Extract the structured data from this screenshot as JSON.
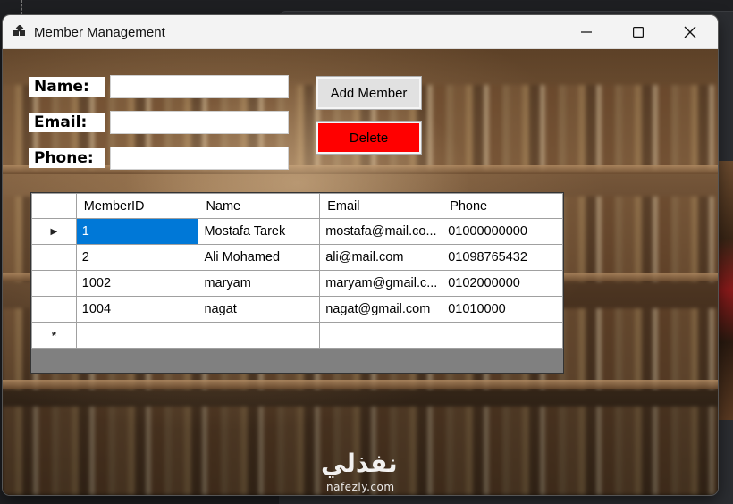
{
  "window": {
    "title": "Member Management"
  },
  "form": {
    "name_label": "Name:",
    "email_label": "Email:",
    "phone_label": "Phone:",
    "name_value": "",
    "email_value": "",
    "phone_value": ""
  },
  "buttons": {
    "add_label": "Add Member",
    "delete_label": "Delete"
  },
  "grid": {
    "columns": [
      "MemberID",
      "Name",
      "Email",
      "Phone"
    ],
    "rows": [
      {
        "id": "1",
        "name": "Mostafa Tarek",
        "email": "mostafa@mail.co...",
        "phone": "01000000000"
      },
      {
        "id": "2",
        "name": "Ali Mohamed",
        "email": "ali@mail.com",
        "phone": "01098765432"
      },
      {
        "id": "1002",
        "name": "maryam",
        "email": "maryam@gmail.c...",
        "phone": "0102000000"
      },
      {
        "id": "1004",
        "name": "nagat",
        "email": "nagat@gmail.com",
        "phone": "01010000"
      }
    ],
    "current_row_marker": "▶",
    "new_row_marker": "*"
  },
  "watermark": {
    "arabic": "نفذلي",
    "latin": "nafezly.com"
  },
  "colors": {
    "delete_button": "#ff0000",
    "selected_cell": "#0078d7",
    "grid_background": "#808080"
  },
  "icons": {
    "app": "app-windows-icon",
    "minimize": "minimize-icon",
    "maximize": "maximize-icon",
    "close": "close-icon"
  }
}
